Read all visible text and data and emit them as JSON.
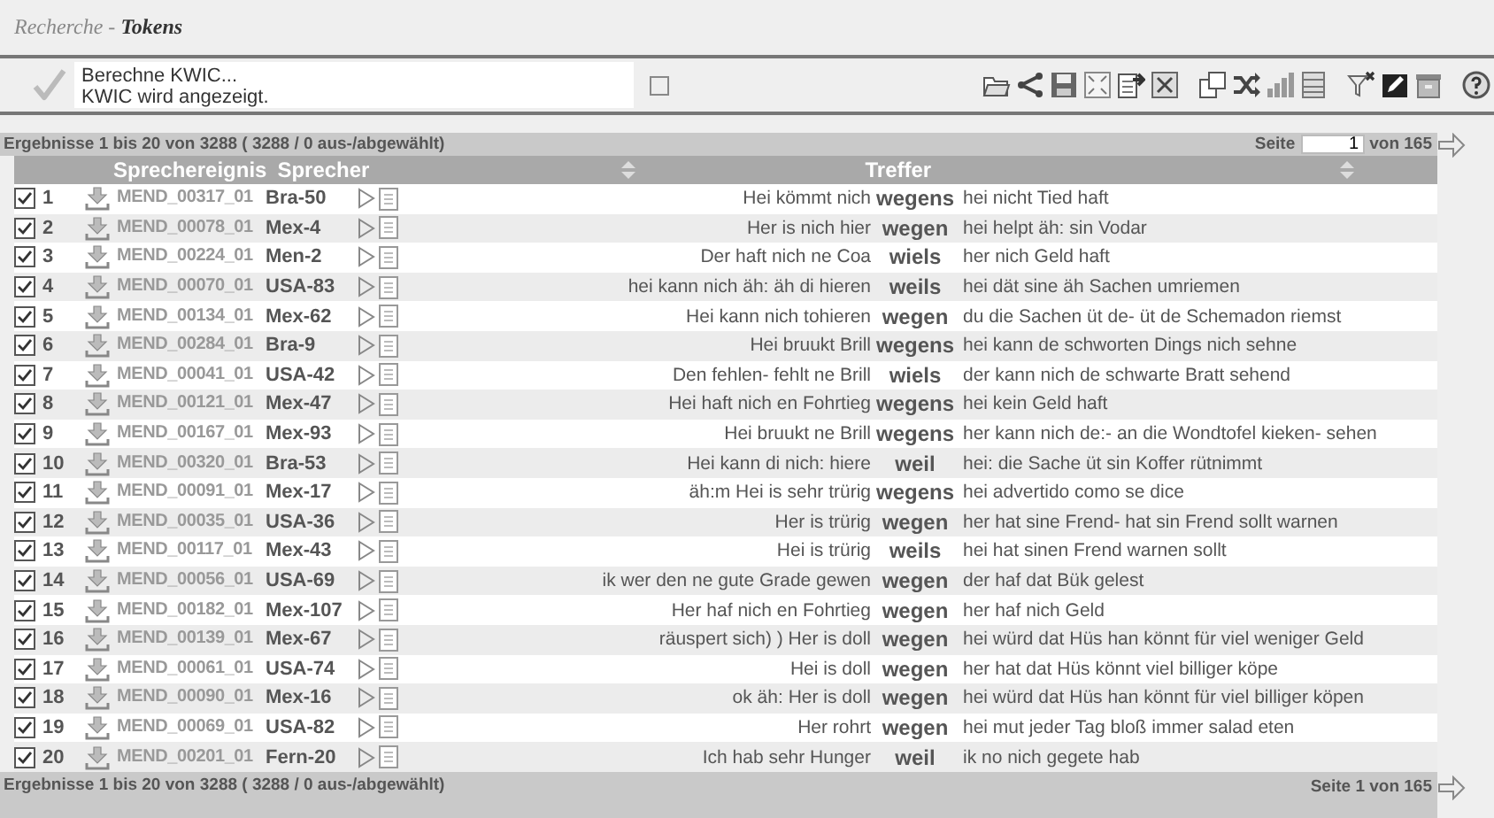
{
  "breadcrumb": "Recherche - **Tokens**",
  "status": {
    "messages": [
      "Berechne KWIC...",
      "KWIC wird angezeigt."
    ],
    "checkbox": {
      "checked": false
    }
  },
  "results_bar": {
    "summary": "Ergebnisse 1 bis 20 von 3288 ( 3288 / 0 aus-/abgewählt)",
    "page_label": "Seite",
    "page_value": "1",
    "page_total": "von 165"
  },
  "columns": [
    "Sprechereignis",
    "Sprecher",
    "Treffer"
  ],
  "rows": [
    {
      "checked": true,
      "number": "1",
      "event": "MEND_00317_01",
      "speaker": "Bra-50",
      "left": "Hei kömmt nich",
      "keyword": "wegens",
      "right": "hei nicht Tied haft"
    },
    {
      "checked": true,
      "number": "2",
      "event": "MEND_00078_01",
      "speaker": "Mex-4",
      "left": "Her is nich hier",
      "keyword": "wegen",
      "right": "hei helpt äh: sin Vodar"
    },
    {
      "checked": true,
      "number": "3",
      "event": "MEND_00224_01",
      "speaker": "Men-2",
      "left": "Der haft nich ne Coa",
      "keyword": "wiels",
      "right": "her nich Geld haft"
    },
    {
      "checked": true,
      "number": "4",
      "event": "MEND_00070_01",
      "speaker": "USA-83",
      "left": "hei kann nich äh: äh di hieren",
      "keyword": "weils",
      "right": "hei dät sine äh Sachen umriemen"
    },
    {
      "checked": true,
      "number": "5",
      "event": "MEND_00134_01",
      "speaker": "Mex-62",
      "left": "Hei kann nich tohieren",
      "keyword": "wegen",
      "right": "du die Sachen üt de- üt de Schemadon riemst"
    },
    {
      "checked": true,
      "number": "6",
      "event": "MEND_00284_01",
      "speaker": "Bra-9",
      "left": "Hei bruukt Brill",
      "keyword": "wegens",
      "right": "hei kann de schworten Dings nich sehne"
    },
    {
      "checked": true,
      "number": "7",
      "event": "MEND_00041_01",
      "speaker": "USA-42",
      "left": "Den fehlen- fehlt ne Brill",
      "keyword": "wiels",
      "right": "der kann nich de schwarte Bratt sehend"
    },
    {
      "checked": true,
      "number": "8",
      "event": "MEND_00121_01",
      "speaker": "Mex-47",
      "left": "Hei haft nich en Fohrtieg",
      "keyword": "wegens",
      "right": "hei kein Geld haft"
    },
    {
      "checked": true,
      "number": "9",
      "event": "MEND_00167_01",
      "speaker": "Mex-93",
      "left": "Hei bruukt ne Brill",
      "keyword": "wegens",
      "right": "her kann nich de:- an die Wondtofel kieken- sehen"
    },
    {
      "checked": true,
      "number": "10",
      "event": "MEND_00320_01",
      "speaker": "Bra-53",
      "left": "Hei kann di nich: hiere",
      "keyword": "weil",
      "right": "hei: die Sache üt sin Koffer rütnimmt"
    },
    {
      "checked": true,
      "number": "11",
      "event": "MEND_00091_01",
      "speaker": "Mex-17",
      "left": "äh:m Hei is sehr trürig",
      "keyword": "wegens",
      "right": "hei advertido como se dice"
    },
    {
      "checked": true,
      "number": "12",
      "event": "MEND_00035_01",
      "speaker": "USA-36",
      "left": "Her is trürig",
      "keyword": "wegen",
      "right": "her hat sine Frend- hat sin Frend sollt warnen"
    },
    {
      "checked": true,
      "number": "13",
      "event": "MEND_00117_01",
      "speaker": "Mex-43",
      "left": "Hei is trürig",
      "keyword": "weils",
      "right": "hei hat sinen Frend warnen sollt"
    },
    {
      "checked": true,
      "number": "14",
      "event": "MEND_00056_01",
      "speaker": "USA-69",
      "left": "ik wer den ne gute Grade gewen",
      "keyword": "wegen",
      "right": "der haf dat Bük gelest"
    },
    {
      "checked": true,
      "number": "15",
      "event": "MEND_00182_01",
      "speaker": "Mex-107",
      "left": "Her haf nich en Fohrtieg",
      "keyword": "wegen",
      "right": "her haf nich Geld"
    },
    {
      "checked": true,
      "number": "16",
      "event": "MEND_00139_01",
      "speaker": "Mex-67",
      "left": "räuspert sich) ) Her is doll",
      "keyword": "wegen",
      "right": "hei würd dat Hüs han könnt für viel weniger Geld"
    },
    {
      "checked": true,
      "number": "17",
      "event": "MEND_00061_01",
      "speaker": "USA-74",
      "left": "Hei is doll",
      "keyword": "wegen",
      "right": "her hat dat Hüs könnt viel billiger köpe"
    },
    {
      "checked": true,
      "number": "18",
      "event": "MEND_00090_01",
      "speaker": "Mex-16",
      "left": "ok äh: Her is doll",
      "keyword": "wegen",
      "right": "hei würd dat Hüs han könnt für viel billiger köpen"
    },
    {
      "checked": true,
      "number": "19",
      "event": "MEND_00069_01",
      "speaker": "USA-82",
      "left": "Her rohrt",
      "keyword": "wegen",
      "right": "hei mut jeder Tag bloß immer salad eten"
    },
    {
      "checked": true,
      "number": "20",
      "event": "MEND_00201_01",
      "speaker": "Fern-20",
      "left": "Ich hab sehr Hunger",
      "keyword": "weil",
      "right": "ik no nich gegete hab"
    }
  ],
  "footer": {
    "summary": "Ergebnisse 1 bis 20 von 3288 ( 3288 / 0 aus-/abgewählt)",
    "pages": "Seite 1 von 165"
  }
}
